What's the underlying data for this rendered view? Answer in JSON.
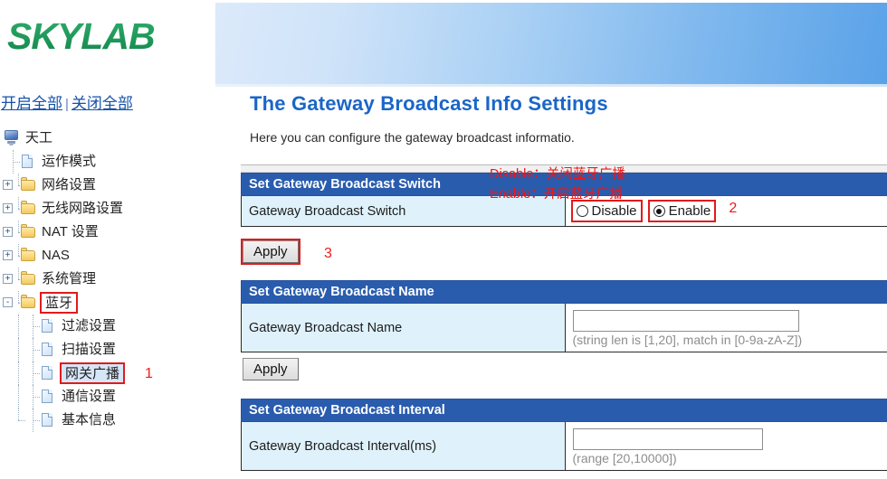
{
  "brand": {
    "logo_text": "SKYLAB"
  },
  "tree_links": {
    "expand_all": "开启全部",
    "separator": "|",
    "collapse_all": "关闭全部"
  },
  "tree": {
    "root": {
      "label": "天工",
      "icon": "monitor-icon"
    },
    "items": [
      {
        "label": "运作模式",
        "icon": "page-icon",
        "type": "page",
        "expander": "",
        "depth": 1,
        "selected": false
      },
      {
        "label": "网络设置",
        "icon": "folder-icon",
        "type": "folder",
        "expander": "+",
        "depth": 1,
        "selected": false
      },
      {
        "label": "无线网路设置",
        "icon": "folder-icon",
        "type": "folder",
        "expander": "+",
        "depth": 1,
        "selected": false
      },
      {
        "label": "NAT 设置",
        "icon": "folder-icon",
        "type": "folder",
        "expander": "+",
        "depth": 1,
        "selected": false
      },
      {
        "label": "NAS",
        "icon": "folder-icon",
        "type": "folder",
        "expander": "+",
        "depth": 1,
        "selected": false
      },
      {
        "label": "系统管理",
        "icon": "folder-icon",
        "type": "folder",
        "expander": "+",
        "depth": 1,
        "selected": false
      },
      {
        "label": "蓝牙",
        "icon": "folder-icon",
        "type": "folder",
        "expander": "-",
        "depth": 1,
        "selected": false,
        "annotated": true
      },
      {
        "label": "过滤设置",
        "icon": "page-icon",
        "type": "page",
        "expander": "",
        "depth": 2,
        "selected": false
      },
      {
        "label": "扫描设置",
        "icon": "page-icon",
        "type": "page",
        "expander": "",
        "depth": 2,
        "selected": false
      },
      {
        "label": "网关广播",
        "icon": "page-icon",
        "type": "page",
        "expander": "",
        "depth": 2,
        "selected": true,
        "annotated": true
      },
      {
        "label": "通信设置",
        "icon": "page-icon",
        "type": "page",
        "expander": "",
        "depth": 2,
        "selected": false
      },
      {
        "label": "基本信息",
        "icon": "page-icon",
        "type": "page",
        "expander": "",
        "depth": 2,
        "selected": false
      }
    ]
  },
  "main": {
    "title": "The Gateway Broadcast Info Settings",
    "description": "Here you can configure the gateway broadcast informatio.",
    "sections": {
      "switch": {
        "header": "Set Gateway Broadcast Switch",
        "row_label": "Gateway Broadcast Switch",
        "options": [
          {
            "label": "Disable",
            "checked": false
          },
          {
            "label": "Enable",
            "checked": true
          }
        ],
        "apply_label": "Apply"
      },
      "name": {
        "header": "Set Gateway Broadcast Name",
        "row_label": "Gateway Broadcast Name",
        "input_value": "",
        "hint": "(string len is [1,20], match in [0-9a-zA-Z])",
        "apply_label": "Apply"
      },
      "interval": {
        "header": "Set Gateway Broadcast Interval",
        "row_label": "Gateway Broadcast Interval(ms)",
        "input_value": "",
        "hint": "(range [20,10000])"
      }
    }
  },
  "annotations": {
    "color": "#f01414",
    "note_disable": "Disable：关闭蓝牙广播",
    "note_enable": "Enable：开启蓝牙广播",
    "num_1": "1",
    "num_2": "2",
    "num_3": "3"
  }
}
